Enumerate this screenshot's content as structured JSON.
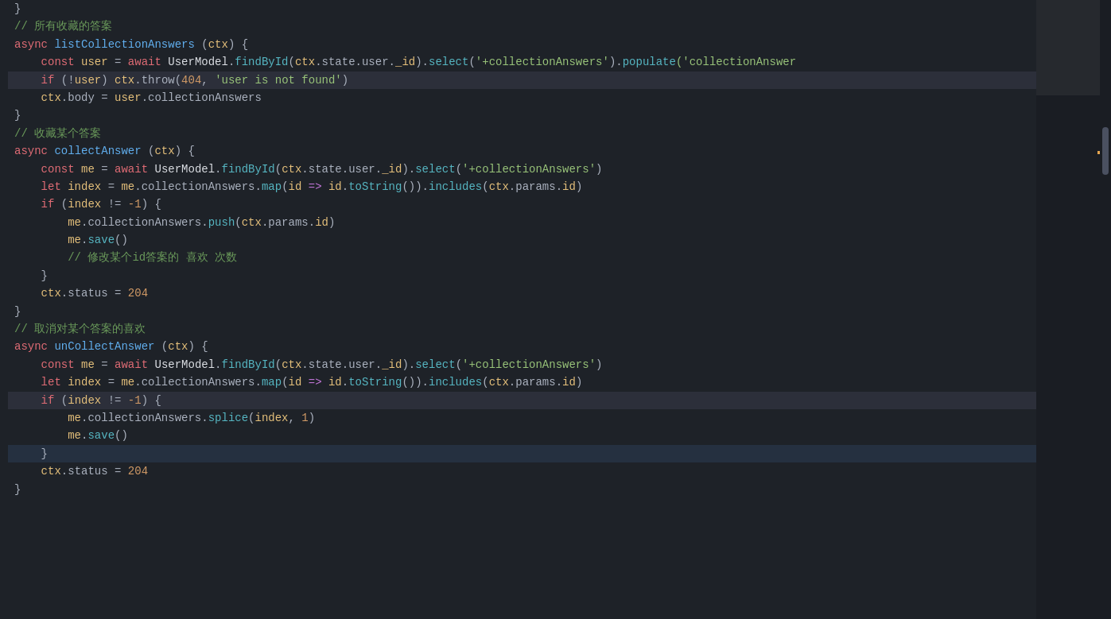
{
  "code": {
    "lines": [
      {
        "id": 1,
        "tokens": [
          {
            "text": "}",
            "cls": "c-plain"
          }
        ]
      },
      {
        "id": 2,
        "tokens": [
          {
            "text": "// ",
            "cls": "c-comment"
          },
          {
            "text": "所有收藏的答案",
            "cls": "c-comment"
          }
        ]
      },
      {
        "id": 3,
        "tokens": [
          {
            "text": "async ",
            "cls": "c-keyword"
          },
          {
            "text": "listCollectionAnswers",
            "cls": "c-func"
          },
          {
            "text": " (",
            "cls": "c-plain"
          },
          {
            "text": "ctx",
            "cls": "c-param"
          },
          {
            "text": ") {",
            "cls": "c-plain"
          }
        ]
      },
      {
        "id": 4,
        "tokens": [
          {
            "text": "    ",
            "cls": "c-plain"
          },
          {
            "text": "const ",
            "cls": "c-keyword"
          },
          {
            "text": "user",
            "cls": "c-var"
          },
          {
            "text": " = ",
            "cls": "c-plain"
          },
          {
            "text": "await ",
            "cls": "c-keyword"
          },
          {
            "text": "UserModel",
            "cls": "c-white"
          },
          {
            "text": ".",
            "cls": "c-plain"
          },
          {
            "text": "findById",
            "cls": "c-method"
          },
          {
            "text": "(",
            "cls": "c-plain"
          },
          {
            "text": "ctx",
            "cls": "c-var"
          },
          {
            "text": ".state.user.",
            "cls": "c-plain"
          },
          {
            "text": "_id",
            "cls": "c-var"
          },
          {
            "text": ").",
            "cls": "c-plain"
          },
          {
            "text": "select",
            "cls": "c-method"
          },
          {
            "text": "(",
            "cls": "c-plain"
          },
          {
            "text": "'+collectionAnswers'",
            "cls": "c-green"
          },
          {
            "text": ").",
            "cls": "c-plain"
          },
          {
            "text": "populate",
            "cls": "c-method"
          },
          {
            "text": "('collectionAnswer",
            "cls": "c-green"
          }
        ]
      },
      {
        "id": 5,
        "tokens": [
          {
            "text": "    ",
            "cls": "c-plain"
          },
          {
            "text": "if ",
            "cls": "c-keyword"
          },
          {
            "text": "(!",
            "cls": "c-plain"
          },
          {
            "text": "user",
            "cls": "c-var"
          },
          {
            "text": ") ",
            "cls": "c-plain"
          },
          {
            "text": "ctx",
            "cls": "c-var"
          },
          {
            "text": ".throw(",
            "cls": "c-plain"
          },
          {
            "text": "404",
            "cls": "c-number"
          },
          {
            "text": ", ",
            "cls": "c-plain"
          },
          {
            "text": "'user is not found'",
            "cls": "c-green"
          },
          {
            "text": ")",
            "cls": "c-plain"
          }
        ],
        "highlight": true
      },
      {
        "id": 6,
        "tokens": [
          {
            "text": "    ",
            "cls": "c-plain"
          },
          {
            "text": "ctx",
            "cls": "c-var"
          },
          {
            "text": ".body = ",
            "cls": "c-plain"
          },
          {
            "text": "user",
            "cls": "c-var"
          },
          {
            "text": ".collectionAnswers",
            "cls": "c-plain"
          }
        ]
      },
      {
        "id": 7,
        "tokens": [
          {
            "text": "}",
            "cls": "c-plain"
          }
        ]
      },
      {
        "id": 8,
        "tokens": [
          {
            "text": "// ",
            "cls": "c-comment"
          },
          {
            "text": "收藏某个答案",
            "cls": "c-comment"
          }
        ]
      },
      {
        "id": 9,
        "tokens": [
          {
            "text": "async ",
            "cls": "c-keyword"
          },
          {
            "text": "collectAnswer",
            "cls": "c-func"
          },
          {
            "text": " (",
            "cls": "c-plain"
          },
          {
            "text": "ctx",
            "cls": "c-param"
          },
          {
            "text": ") {",
            "cls": "c-plain"
          }
        ]
      },
      {
        "id": 10,
        "tokens": [
          {
            "text": "    ",
            "cls": "c-plain"
          },
          {
            "text": "const ",
            "cls": "c-keyword"
          },
          {
            "text": "me",
            "cls": "c-var"
          },
          {
            "text": " = ",
            "cls": "c-plain"
          },
          {
            "text": "await ",
            "cls": "c-keyword"
          },
          {
            "text": "UserModel",
            "cls": "c-white"
          },
          {
            "text": ".",
            "cls": "c-plain"
          },
          {
            "text": "findById",
            "cls": "c-method"
          },
          {
            "text": "(",
            "cls": "c-plain"
          },
          {
            "text": "ctx",
            "cls": "c-var"
          },
          {
            "text": ".state.user.",
            "cls": "c-plain"
          },
          {
            "text": "_id",
            "cls": "c-var"
          },
          {
            "text": ").",
            "cls": "c-plain"
          },
          {
            "text": "select",
            "cls": "c-method"
          },
          {
            "text": "(",
            "cls": "c-plain"
          },
          {
            "text": "'+collectionAnswers'",
            "cls": "c-green"
          },
          {
            "text": ")",
            "cls": "c-plain"
          }
        ]
      },
      {
        "id": 11,
        "tokens": [
          {
            "text": "    ",
            "cls": "c-plain"
          },
          {
            "text": "let ",
            "cls": "c-keyword"
          },
          {
            "text": "index",
            "cls": "c-var"
          },
          {
            "text": " = ",
            "cls": "c-plain"
          },
          {
            "text": "me",
            "cls": "c-var"
          },
          {
            "text": ".collectionAnswers.",
            "cls": "c-plain"
          },
          {
            "text": "map",
            "cls": "c-method"
          },
          {
            "text": "(",
            "cls": "c-plain"
          },
          {
            "text": "id",
            "cls": "c-var"
          },
          {
            "text": " => ",
            "cls": "c-arrow"
          },
          {
            "text": "id",
            "cls": "c-var"
          },
          {
            "text": ".",
            "cls": "c-plain"
          },
          {
            "text": "toString",
            "cls": "c-method"
          },
          {
            "text": "()).",
            "cls": "c-plain"
          },
          {
            "text": "includes",
            "cls": "c-method"
          },
          {
            "text": "(",
            "cls": "c-plain"
          },
          {
            "text": "ctx",
            "cls": "c-var"
          },
          {
            "text": ".params.",
            "cls": "c-plain"
          },
          {
            "text": "id",
            "cls": "c-var"
          },
          {
            "text": ")",
            "cls": "c-plain"
          }
        ]
      },
      {
        "id": 12,
        "tokens": [
          {
            "text": "    ",
            "cls": "c-plain"
          },
          {
            "text": "if ",
            "cls": "c-keyword"
          },
          {
            "text": "(",
            "cls": "c-plain"
          },
          {
            "text": "index",
            "cls": "c-var"
          },
          {
            "text": " != ",
            "cls": "c-plain"
          },
          {
            "text": "-1",
            "cls": "c-number"
          },
          {
            "text": ") {",
            "cls": "c-plain"
          }
        ]
      },
      {
        "id": 13,
        "tokens": [
          {
            "text": "        ",
            "cls": "c-plain"
          },
          {
            "text": "me",
            "cls": "c-var"
          },
          {
            "text": ".collectionAnswers.",
            "cls": "c-plain"
          },
          {
            "text": "push",
            "cls": "c-method"
          },
          {
            "text": "(",
            "cls": "c-plain"
          },
          {
            "text": "ctx",
            "cls": "c-var"
          },
          {
            "text": ".params.",
            "cls": "c-plain"
          },
          {
            "text": "id",
            "cls": "c-var"
          },
          {
            "text": ")",
            "cls": "c-plain"
          }
        ]
      },
      {
        "id": 14,
        "tokens": [
          {
            "text": "        ",
            "cls": "c-plain"
          },
          {
            "text": "me",
            "cls": "c-var"
          },
          {
            "text": ".",
            "cls": "c-plain"
          },
          {
            "text": "save",
            "cls": "c-method"
          },
          {
            "text": "()",
            "cls": "c-plain"
          }
        ]
      },
      {
        "id": 15,
        "tokens": [
          {
            "text": "        ",
            "cls": "c-plain"
          },
          {
            "text": "// ",
            "cls": "c-comment"
          },
          {
            "text": "修改某个id答案的 喜欢 次数",
            "cls": "c-comment"
          }
        ]
      },
      {
        "id": 16,
        "tokens": [
          {
            "text": "    ",
            "cls": "c-plain"
          },
          {
            "text": "}",
            "cls": "c-plain"
          }
        ]
      },
      {
        "id": 17,
        "tokens": [
          {
            "text": "    ",
            "cls": "c-plain"
          },
          {
            "text": "ctx",
            "cls": "c-var"
          },
          {
            "text": ".status = ",
            "cls": "c-plain"
          },
          {
            "text": "204",
            "cls": "c-number"
          }
        ]
      },
      {
        "id": 18,
        "tokens": [
          {
            "text": "}",
            "cls": "c-plain"
          }
        ]
      },
      {
        "id": 19,
        "tokens": [
          {
            "text": "// ",
            "cls": "c-comment"
          },
          {
            "text": "取消对某个答案的喜欢",
            "cls": "c-comment"
          }
        ]
      },
      {
        "id": 20,
        "tokens": [
          {
            "text": "async ",
            "cls": "c-keyword"
          },
          {
            "text": "unCollectAnswer",
            "cls": "c-func"
          },
          {
            "text": " (",
            "cls": "c-plain"
          },
          {
            "text": "ctx",
            "cls": "c-param"
          },
          {
            "text": ") {",
            "cls": "c-plain"
          }
        ]
      },
      {
        "id": 21,
        "tokens": [
          {
            "text": "    ",
            "cls": "c-plain"
          },
          {
            "text": "const ",
            "cls": "c-keyword"
          },
          {
            "text": "me",
            "cls": "c-var"
          },
          {
            "text": " = ",
            "cls": "c-plain"
          },
          {
            "text": "await ",
            "cls": "c-keyword"
          },
          {
            "text": "UserModel",
            "cls": "c-white"
          },
          {
            "text": ".",
            "cls": "c-plain"
          },
          {
            "text": "findById",
            "cls": "c-method"
          },
          {
            "text": "(",
            "cls": "c-plain"
          },
          {
            "text": "ctx",
            "cls": "c-var"
          },
          {
            "text": ".state.user.",
            "cls": "c-plain"
          },
          {
            "text": "_id",
            "cls": "c-var"
          },
          {
            "text": ").",
            "cls": "c-plain"
          },
          {
            "text": "select",
            "cls": "c-method"
          },
          {
            "text": "(",
            "cls": "c-plain"
          },
          {
            "text": "'+collectionAnswers'",
            "cls": "c-green"
          },
          {
            "text": ")",
            "cls": "c-plain"
          }
        ]
      },
      {
        "id": 22,
        "tokens": [
          {
            "text": "    ",
            "cls": "c-plain"
          },
          {
            "text": "let ",
            "cls": "c-keyword"
          },
          {
            "text": "index",
            "cls": "c-var"
          },
          {
            "text": " = ",
            "cls": "c-plain"
          },
          {
            "text": "me",
            "cls": "c-var"
          },
          {
            "text": ".collectionAnswers.",
            "cls": "c-plain"
          },
          {
            "text": "map",
            "cls": "c-method"
          },
          {
            "text": "(",
            "cls": "c-plain"
          },
          {
            "text": "id",
            "cls": "c-var"
          },
          {
            "text": " => ",
            "cls": "c-arrow"
          },
          {
            "text": "id",
            "cls": "c-var"
          },
          {
            "text": ".",
            "cls": "c-plain"
          },
          {
            "text": "toString",
            "cls": "c-method"
          },
          {
            "text": "()).",
            "cls": "c-plain"
          },
          {
            "text": "includes",
            "cls": "c-method"
          },
          {
            "text": "(",
            "cls": "c-plain"
          },
          {
            "text": "ctx",
            "cls": "c-var"
          },
          {
            "text": ".params.",
            "cls": "c-plain"
          },
          {
            "text": "id",
            "cls": "c-var"
          },
          {
            "text": ")",
            "cls": "c-plain"
          }
        ]
      },
      {
        "id": 23,
        "tokens": [
          {
            "text": "    ",
            "cls": "c-plain"
          },
          {
            "text": "if ",
            "cls": "c-keyword"
          },
          {
            "text": "(",
            "cls": "c-plain"
          },
          {
            "text": "index",
            "cls": "c-var"
          },
          {
            "text": " != ",
            "cls": "c-plain"
          },
          {
            "text": "-1",
            "cls": "c-number"
          },
          {
            "text": ") {",
            "cls": "c-plain"
          }
        ],
        "highlight": true
      },
      {
        "id": 24,
        "tokens": [
          {
            "text": "        ",
            "cls": "c-plain"
          },
          {
            "text": "me",
            "cls": "c-var"
          },
          {
            "text": ".collectionAnswers.",
            "cls": "c-plain"
          },
          {
            "text": "splice",
            "cls": "c-method"
          },
          {
            "text": "(",
            "cls": "c-plain"
          },
          {
            "text": "index",
            "cls": "c-var"
          },
          {
            "text": ", ",
            "cls": "c-plain"
          },
          {
            "text": "1",
            "cls": "c-number"
          },
          {
            "text": ")",
            "cls": "c-plain"
          }
        ]
      },
      {
        "id": 25,
        "tokens": [
          {
            "text": "        ",
            "cls": "c-plain"
          },
          {
            "text": "me",
            "cls": "c-var"
          },
          {
            "text": ".",
            "cls": "c-plain"
          },
          {
            "text": "save",
            "cls": "c-method"
          },
          {
            "text": "()",
            "cls": "c-plain"
          }
        ]
      },
      {
        "id": 26,
        "tokens": [
          {
            "text": "    ",
            "cls": "c-plain"
          },
          {
            "text": "}",
            "cls": "c-plain"
          }
        ],
        "highlight_bracket": true
      },
      {
        "id": 27,
        "tokens": [
          {
            "text": "    ",
            "cls": "c-plain"
          },
          {
            "text": "ctx",
            "cls": "c-var"
          },
          {
            "text": ".status = ",
            "cls": "c-plain"
          },
          {
            "text": "204",
            "cls": "c-number"
          }
        ]
      },
      {
        "id": 28,
        "tokens": [
          {
            "text": "}",
            "cls": "c-plain"
          }
        ]
      }
    ]
  }
}
